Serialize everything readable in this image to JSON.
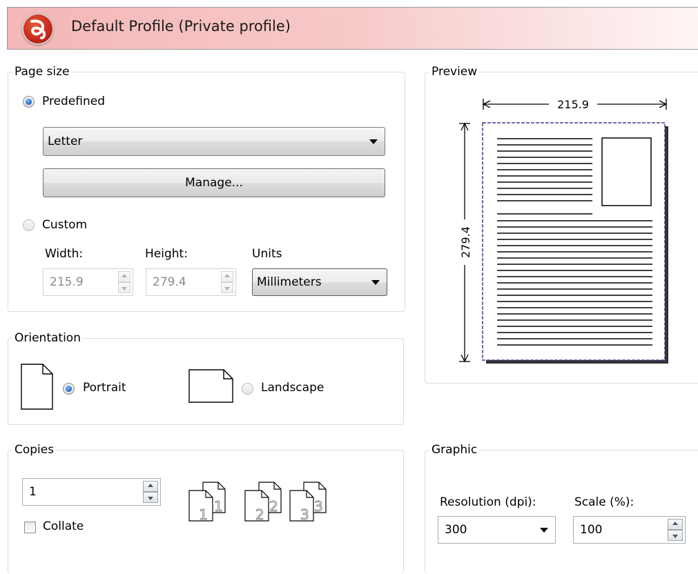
{
  "header": {
    "title": "Default Profile (Private profile)",
    "logo_color": "#c7281c",
    "gradient_start": "#f4b7b7"
  },
  "page_size": {
    "legend": "Page size",
    "predefined_label": "Predefined",
    "predefined_selected": true,
    "paper": "Letter",
    "manage_label": "Manage...",
    "custom_label": "Custom",
    "custom_selected": false,
    "width_label": "Width:",
    "height_label": "Height:",
    "units_label": "Units",
    "width_value": "215.9",
    "height_value": "279.4",
    "units_value": "Millimeters"
  },
  "preview": {
    "legend": "Preview",
    "width_dim": "215.9",
    "height_dim": "279.4"
  },
  "orientation": {
    "legend": "Orientation",
    "portrait_label": "Portrait",
    "landscape_label": "Landscape",
    "selected": "Portrait"
  },
  "copies": {
    "legend": "Copies",
    "value": "1",
    "collate_label": "Collate",
    "collate_checked": false,
    "icon_numbers": [
      "1",
      "1",
      "2",
      "2",
      "3",
      "3"
    ]
  },
  "graphic": {
    "legend": "Graphic",
    "resolution_label": "Resolution (dpi):",
    "resolution_value": "300",
    "scale_label": "Scale (%):",
    "scale_value": "100"
  },
  "icons": {
    "accent": "#1c5fb8"
  }
}
